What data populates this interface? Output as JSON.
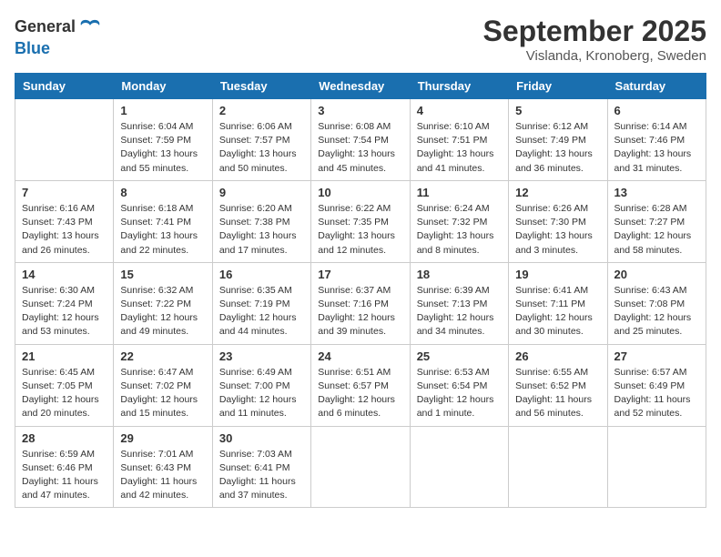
{
  "logo": {
    "general": "General",
    "blue": "Blue"
  },
  "header": {
    "month": "September 2025",
    "location": "Vislanda, Kronoberg, Sweden"
  },
  "weekdays": [
    "Sunday",
    "Monday",
    "Tuesday",
    "Wednesday",
    "Thursday",
    "Friday",
    "Saturday"
  ],
  "weeks": [
    [
      {
        "day": "",
        "info": ""
      },
      {
        "day": "1",
        "info": "Sunrise: 6:04 AM\nSunset: 7:59 PM\nDaylight: 13 hours\nand 55 minutes."
      },
      {
        "day": "2",
        "info": "Sunrise: 6:06 AM\nSunset: 7:57 PM\nDaylight: 13 hours\nand 50 minutes."
      },
      {
        "day": "3",
        "info": "Sunrise: 6:08 AM\nSunset: 7:54 PM\nDaylight: 13 hours\nand 45 minutes."
      },
      {
        "day": "4",
        "info": "Sunrise: 6:10 AM\nSunset: 7:51 PM\nDaylight: 13 hours\nand 41 minutes."
      },
      {
        "day": "5",
        "info": "Sunrise: 6:12 AM\nSunset: 7:49 PM\nDaylight: 13 hours\nand 36 minutes."
      },
      {
        "day": "6",
        "info": "Sunrise: 6:14 AM\nSunset: 7:46 PM\nDaylight: 13 hours\nand 31 minutes."
      }
    ],
    [
      {
        "day": "7",
        "info": "Sunrise: 6:16 AM\nSunset: 7:43 PM\nDaylight: 13 hours\nand 26 minutes."
      },
      {
        "day": "8",
        "info": "Sunrise: 6:18 AM\nSunset: 7:41 PM\nDaylight: 13 hours\nand 22 minutes."
      },
      {
        "day": "9",
        "info": "Sunrise: 6:20 AM\nSunset: 7:38 PM\nDaylight: 13 hours\nand 17 minutes."
      },
      {
        "day": "10",
        "info": "Sunrise: 6:22 AM\nSunset: 7:35 PM\nDaylight: 13 hours\nand 12 minutes."
      },
      {
        "day": "11",
        "info": "Sunrise: 6:24 AM\nSunset: 7:32 PM\nDaylight: 13 hours\nand 8 minutes."
      },
      {
        "day": "12",
        "info": "Sunrise: 6:26 AM\nSunset: 7:30 PM\nDaylight: 13 hours\nand 3 minutes."
      },
      {
        "day": "13",
        "info": "Sunrise: 6:28 AM\nSunset: 7:27 PM\nDaylight: 12 hours\nand 58 minutes."
      }
    ],
    [
      {
        "day": "14",
        "info": "Sunrise: 6:30 AM\nSunset: 7:24 PM\nDaylight: 12 hours\nand 53 minutes."
      },
      {
        "day": "15",
        "info": "Sunrise: 6:32 AM\nSunset: 7:22 PM\nDaylight: 12 hours\nand 49 minutes."
      },
      {
        "day": "16",
        "info": "Sunrise: 6:35 AM\nSunset: 7:19 PM\nDaylight: 12 hours\nand 44 minutes."
      },
      {
        "day": "17",
        "info": "Sunrise: 6:37 AM\nSunset: 7:16 PM\nDaylight: 12 hours\nand 39 minutes."
      },
      {
        "day": "18",
        "info": "Sunrise: 6:39 AM\nSunset: 7:13 PM\nDaylight: 12 hours\nand 34 minutes."
      },
      {
        "day": "19",
        "info": "Sunrise: 6:41 AM\nSunset: 7:11 PM\nDaylight: 12 hours\nand 30 minutes."
      },
      {
        "day": "20",
        "info": "Sunrise: 6:43 AM\nSunset: 7:08 PM\nDaylight: 12 hours\nand 25 minutes."
      }
    ],
    [
      {
        "day": "21",
        "info": "Sunrise: 6:45 AM\nSunset: 7:05 PM\nDaylight: 12 hours\nand 20 minutes."
      },
      {
        "day": "22",
        "info": "Sunrise: 6:47 AM\nSunset: 7:02 PM\nDaylight: 12 hours\nand 15 minutes."
      },
      {
        "day": "23",
        "info": "Sunrise: 6:49 AM\nSunset: 7:00 PM\nDaylight: 12 hours\nand 11 minutes."
      },
      {
        "day": "24",
        "info": "Sunrise: 6:51 AM\nSunset: 6:57 PM\nDaylight: 12 hours\nand 6 minutes."
      },
      {
        "day": "25",
        "info": "Sunrise: 6:53 AM\nSunset: 6:54 PM\nDaylight: 12 hours\nand 1 minute."
      },
      {
        "day": "26",
        "info": "Sunrise: 6:55 AM\nSunset: 6:52 PM\nDaylight: 11 hours\nand 56 minutes."
      },
      {
        "day": "27",
        "info": "Sunrise: 6:57 AM\nSunset: 6:49 PM\nDaylight: 11 hours\nand 52 minutes."
      }
    ],
    [
      {
        "day": "28",
        "info": "Sunrise: 6:59 AM\nSunset: 6:46 PM\nDaylight: 11 hours\nand 47 minutes."
      },
      {
        "day": "29",
        "info": "Sunrise: 7:01 AM\nSunset: 6:43 PM\nDaylight: 11 hours\nand 42 minutes."
      },
      {
        "day": "30",
        "info": "Sunrise: 7:03 AM\nSunset: 6:41 PM\nDaylight: 11 hours\nand 37 minutes."
      },
      {
        "day": "",
        "info": ""
      },
      {
        "day": "",
        "info": ""
      },
      {
        "day": "",
        "info": ""
      },
      {
        "day": "",
        "info": ""
      }
    ]
  ]
}
